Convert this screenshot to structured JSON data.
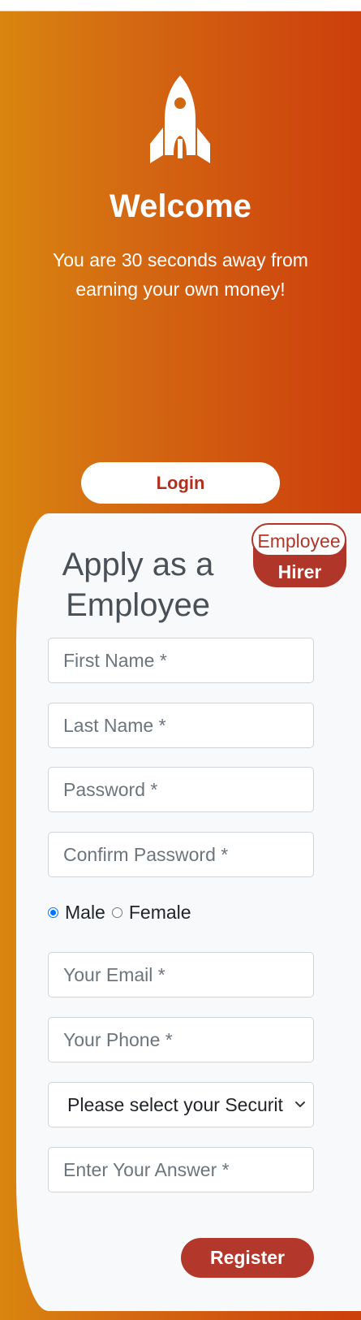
{
  "hero": {
    "icon": "rocket-icon",
    "title": "Welcome",
    "subtitle": "You are 30 seconds away from earning your own money!",
    "login_label": "Login"
  },
  "toggle": {
    "employee_label": "Employee",
    "hirer_label": "Hirer",
    "selected": "Employee"
  },
  "form": {
    "title": "Apply as a Employee",
    "first_name_placeholder": "First Name *",
    "last_name_placeholder": "Last Name *",
    "password_placeholder": "Password *",
    "confirm_password_placeholder": "Confirm Password *",
    "gender": {
      "male_label": "Male",
      "female_label": "Female",
      "selected": "Male"
    },
    "email_placeholder": "Your Email *",
    "phone_placeholder": "Your Phone *",
    "security_question_selected": "Please select your Securit",
    "answer_placeholder": "Enter Your Answer *",
    "register_label": "Register"
  },
  "colors": {
    "gradient_start": "#d9850f",
    "gradient_end": "#cc3f0c",
    "accent": "#b0362a",
    "panel_bg": "#f8f9fb",
    "radio_checked": "#0075ff"
  }
}
